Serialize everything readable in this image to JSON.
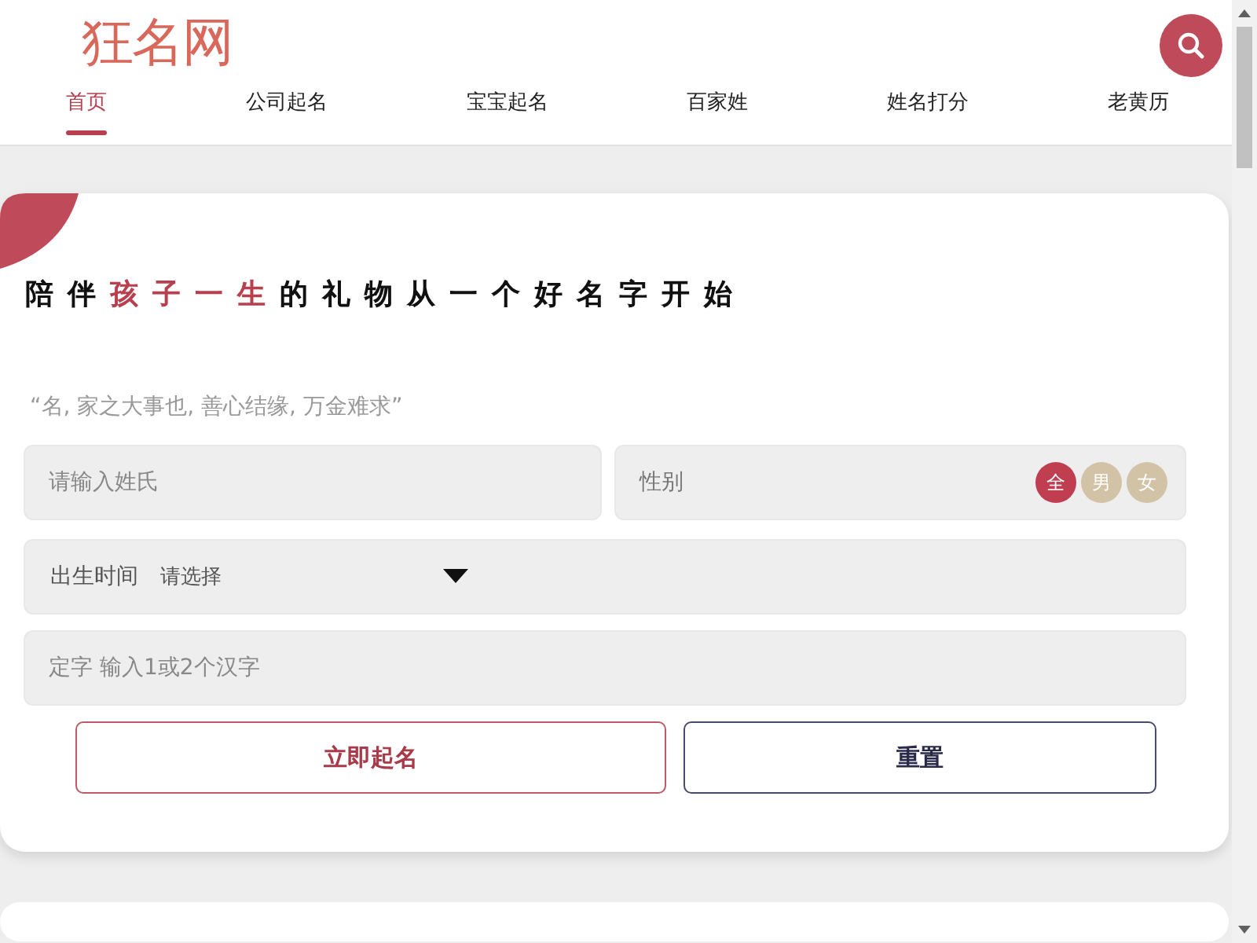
{
  "header": {
    "logo": "狂名网"
  },
  "nav": [
    {
      "label": "首页",
      "selected": true
    },
    {
      "label": "公司起名",
      "selected": false
    },
    {
      "label": "宝宝起名",
      "selected": false
    },
    {
      "label": "百家姓",
      "selected": false
    },
    {
      "label": "姓名打分",
      "selected": false
    },
    {
      "label": "老黄历",
      "selected": false
    }
  ],
  "form": {
    "headline": [
      {
        "text": "陪伴",
        "highlight": false
      },
      {
        "text": "孩子一生",
        "highlight": true
      },
      {
        "text": "的礼物从一个好名字开始",
        "highlight": false
      }
    ],
    "quote": "“名, 家之大事也, 善心结缘, 万金难求”",
    "surname": {
      "placeholder": "请输入姓氏"
    },
    "gender": {
      "label": "性别",
      "options": [
        {
          "label": "全",
          "selected": true
        },
        {
          "label": "男",
          "selected": false
        },
        {
          "label": "女",
          "selected": false
        }
      ]
    },
    "birth": {
      "label": "出生时间",
      "value": "请选择"
    },
    "fixed_char": {
      "placeholder": "定字 输入1或2个汉字"
    },
    "buttons": [
      {
        "label": "立即起名",
        "kind": "primary"
      },
      {
        "label": "重置",
        "kind": "secondary"
      }
    ]
  }
}
